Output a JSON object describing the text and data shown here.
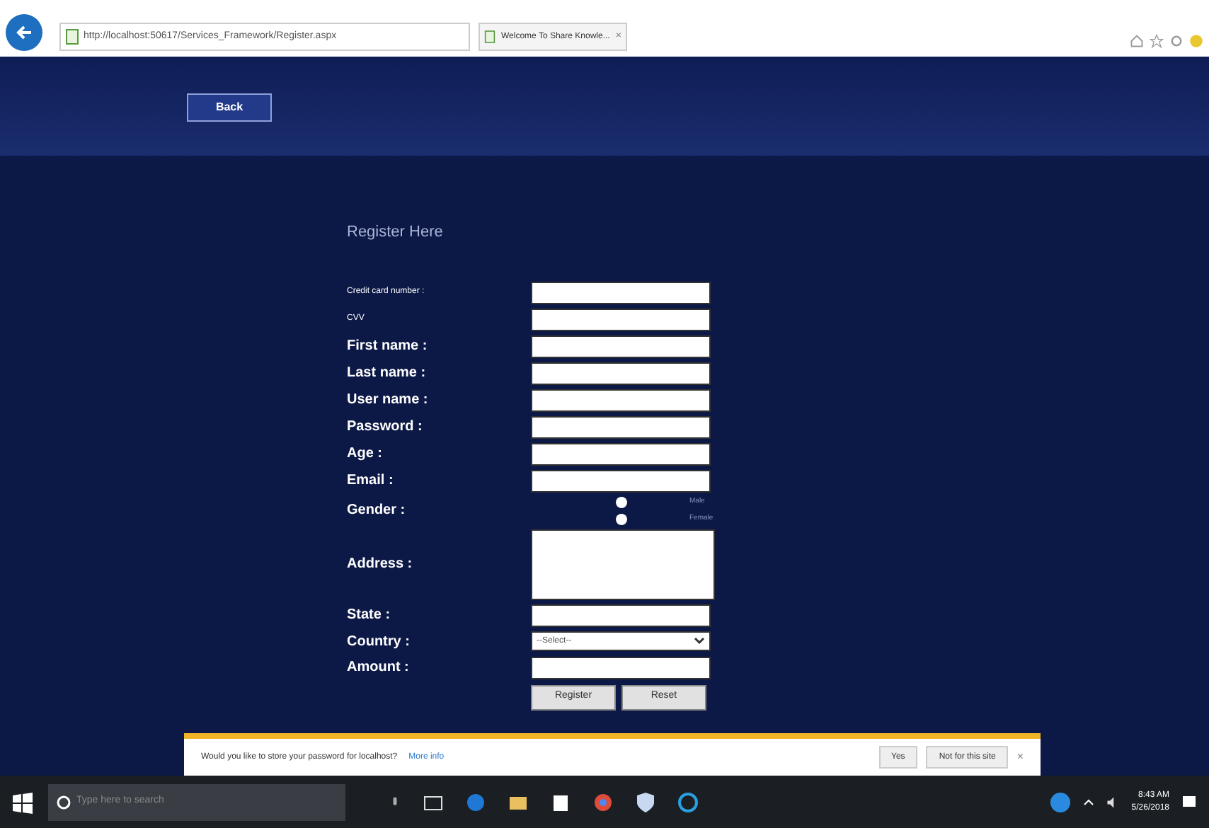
{
  "browser": {
    "address": "http://localhost:50617/Services_Framework/Register.aspx",
    "tab_title": "Welcome To Share Knowle...",
    "tab_close": "×"
  },
  "header": {
    "back_button": "Back"
  },
  "form": {
    "title": "Register Here",
    "fields": [
      {
        "kind": "text",
        "label": "Credit card number :",
        "small": true
      },
      {
        "kind": "text",
        "label": "CVV",
        "small": true
      },
      {
        "kind": "text",
        "label": "First name :",
        "small": false
      },
      {
        "kind": "text",
        "label": "Last name :",
        "small": false
      },
      {
        "kind": "text",
        "label": "User name :",
        "small": false
      },
      {
        "kind": "text",
        "label": "Password :",
        "small": false
      },
      {
        "kind": "text",
        "label": "Age :",
        "small": false
      },
      {
        "kind": "text",
        "label": "Email :",
        "small": false
      },
      {
        "kind": "radio",
        "label": "Gender :",
        "small": false,
        "options": [
          {
            "label": "Male",
            "selected": false
          },
          {
            "label": "Female",
            "selected": false
          }
        ]
      },
      {
        "kind": "textarea",
        "label": "Address :",
        "small": false
      },
      {
        "kind": "text",
        "label": "State :",
        "small": false
      },
      {
        "kind": "select",
        "label": "Country :",
        "small": false,
        "value": "--Select--"
      },
      {
        "kind": "text",
        "label": "Amount :",
        "small": false
      }
    ],
    "buttons": [
      "Register",
      "Reset"
    ]
  },
  "notification": {
    "message": "Would you like to store your password for localhost?",
    "link": "More info",
    "buttons": [
      "Yes",
      "Not for this site"
    ],
    "close": "×"
  },
  "taskbar": {
    "search_placeholder": "Type here to search",
    "time": "8:43 AM",
    "date": "5/26/2018"
  }
}
